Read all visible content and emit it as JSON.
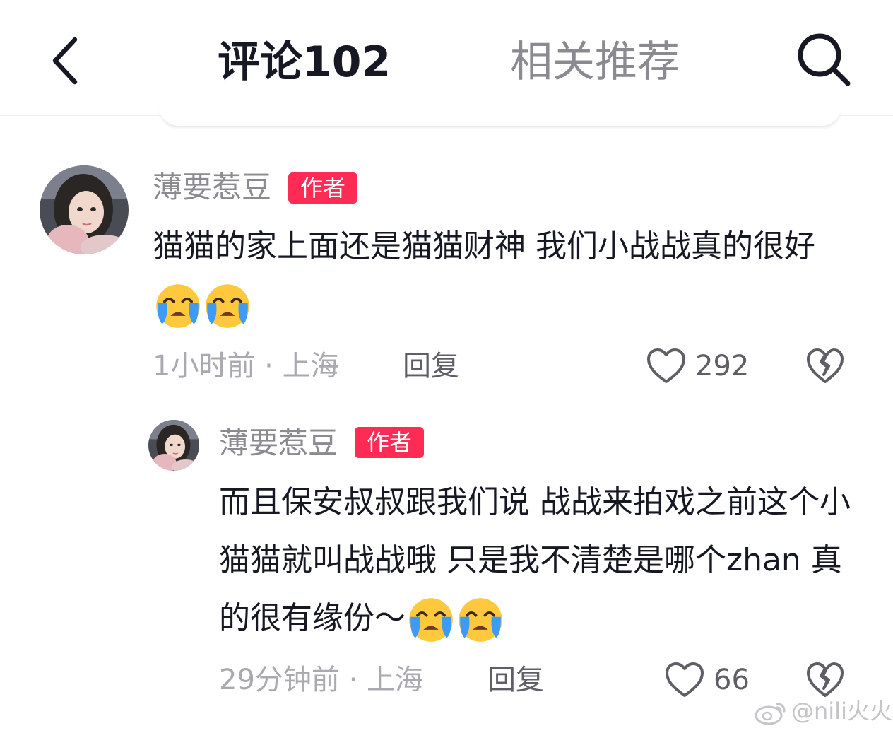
{
  "header": {
    "tab_comments": "评论102",
    "tab_related": "相关推荐",
    "back_icon": "chevron-left-icon",
    "search_icon": "search-icon"
  },
  "colors": {
    "accent": "#fe2c55",
    "text_primary": "#161823",
    "text_secondary": "#8a8b91",
    "emoji_face": "#ffc83d",
    "emoji_tears": "#3d9af5"
  },
  "comments": [
    {
      "username": "薄要惹豆",
      "badge": "作者",
      "text": "猫猫的家上面还是猫猫财神 我们小战战真的很好",
      "emojis": [
        "loudly-crying-face",
        "loudly-crying-face"
      ],
      "time_location": "1小时前 · 上海",
      "reply_label": "回复",
      "likes": "292"
    },
    {
      "username": "薄要惹豆",
      "badge": "作者",
      "text": "而且保安叔叔跟我们说 战战来拍戏之前这个小猫猫就叫战战哦 只是我不清楚是哪个zhan 真的很有缘份～",
      "emojis": [
        "loudly-crying-face",
        "loudly-crying-face"
      ],
      "time_location": "29分钟前 · 上海",
      "reply_label": "回复",
      "likes": "66"
    }
  ],
  "watermark": "@nili火火"
}
